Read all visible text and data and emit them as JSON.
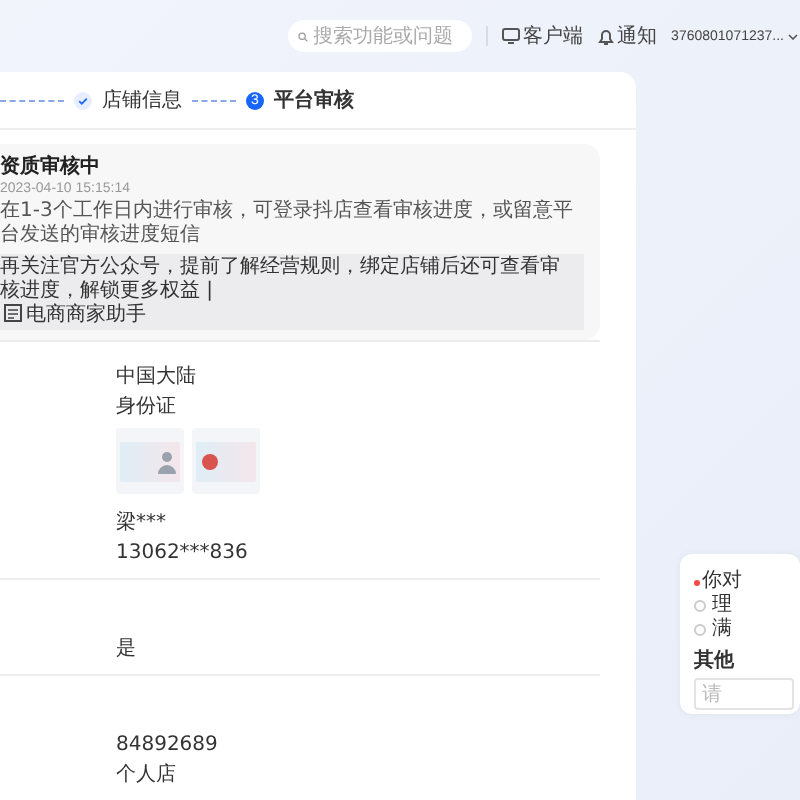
{
  "top_bar": {
    "search": {
      "placeholder": "搜索功能或问题"
    },
    "client_link": "客户端",
    "notifications": "通知",
    "account": "3760801071237..."
  },
  "steps": [
    {
      "kind": "done",
      "label": "店铺信息"
    },
    {
      "kind": "current",
      "number": "3",
      "label": "平台审核"
    }
  ],
  "status_card": {
    "title": "资质审核中",
    "time": "2023-04-10 15:15:14",
    "description": "在1-3个工作日内进行审核，可登录抖店查看审核进度，或留意平台发送的审核进度短信",
    "tip": "再关注官方公众号，提前了解经营规则，绑定店铺后还可查看审核进度，解锁更多权益 |",
    "tip_link": "电商商家助手"
  },
  "sections": [
    {
      "items": [
        {
          "kind": "text",
          "value": "中国大陆"
        },
        {
          "kind": "text",
          "value": "身份证"
        },
        {
          "kind": "photos",
          "photos": [
            {
              "kind": "portrait"
            },
            {
              "kind": "emblem"
            }
          ]
        },
        {
          "kind": "text",
          "value": "梁***"
        },
        {
          "kind": "text",
          "value": "13062***836"
        }
      ]
    },
    {
      "items": [
        {
          "kind": "text",
          "value": "是"
        }
      ]
    },
    {
      "items": [
        {
          "kind": "text",
          "value": "84892689"
        },
        {
          "kind": "text",
          "value": "个人店"
        }
      ]
    }
  ],
  "survey": {
    "question": "你对",
    "required": true,
    "options": [
      {
        "label": "理",
        "selected": false
      },
      {
        "label": "满",
        "selected": false
      }
    ],
    "other_label": "其他",
    "other_input": {
      "placeholder": "请"
    }
  }
}
